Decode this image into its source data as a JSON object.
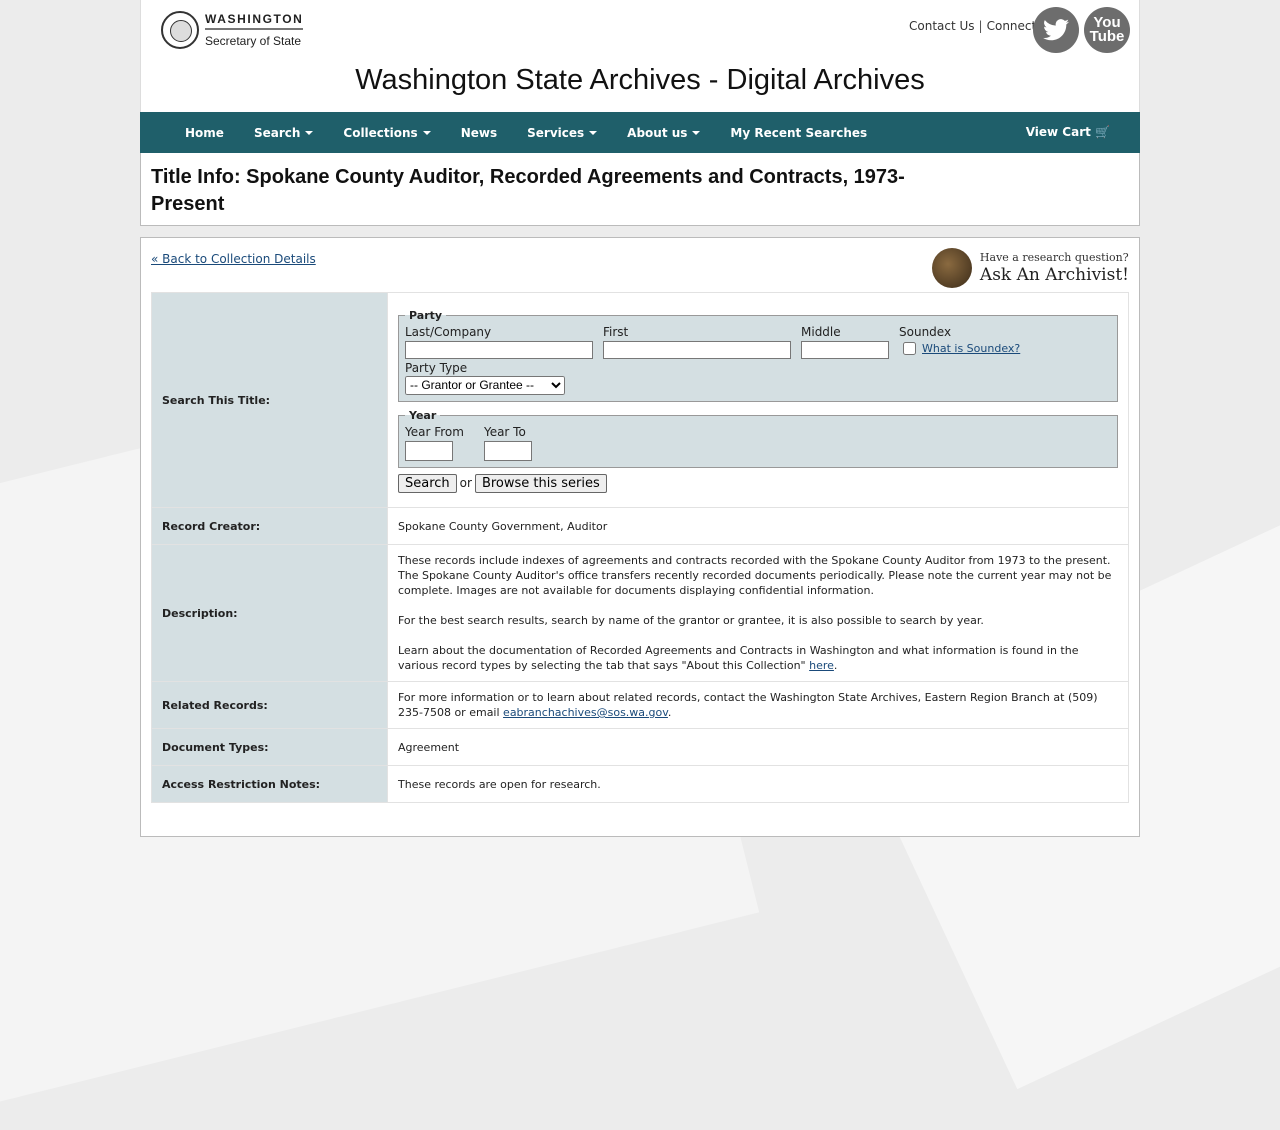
{
  "header": {
    "logo_line1": "WASHINGTON",
    "logo_line2": "Secretary of State",
    "contact": "Contact Us",
    "separator": "|",
    "connect": "Connect:",
    "youtube_label": "You\nTube",
    "site_title": "Washington State Archives - Digital Archives"
  },
  "nav": {
    "items": [
      {
        "label": "Home"
      },
      {
        "label": "Search"
      },
      {
        "label": "Collections"
      },
      {
        "label": "News"
      },
      {
        "label": "Services"
      },
      {
        "label": "About us"
      },
      {
        "label": "My Recent Searches"
      }
    ],
    "cart": "View Cart 🛒"
  },
  "page_title": "Title Info: Spokane County Auditor, Recorded Agreements and Contracts, 1973-Present",
  "back_link": "« Back to Collection Details",
  "archivist": {
    "question": "Have a research question?",
    "ask": "Ask An Archivist!"
  },
  "search": {
    "label": "Search This Title:",
    "party_legend": "Party",
    "last_label": "Last/Company",
    "first_label": "First",
    "middle_label": "Middle",
    "soundex_label": "Soundex",
    "soundex_link": "What is Soundex?",
    "party_type_label": "Party Type",
    "party_type_value": "-- Grantor or Grantee --",
    "year_legend": "Year",
    "year_from_label": "Year From",
    "year_to_label": "Year To",
    "search_button": "Search",
    "or": "or",
    "browse_button": "Browse this series"
  },
  "rows": {
    "creator_label": "Record Creator:",
    "creator_value": "Spokane County Government, Auditor",
    "description_label": "Description:",
    "description_p1": "These records include indexes of agreements and contracts recorded with the Spokane County Auditor from 1973 to the present. The Spokane County Auditor's office transfers recently recorded documents periodically. Please note the current year may not be complete. Images are not available for documents displaying confidential information.",
    "description_p2": "For the best search results, search by name of the grantor or grantee, it is also possible to search by year.",
    "description_p3": "Learn about the documentation of Recorded Agreements and Contracts in Washington and what information is found in the various record types by selecting the tab that says \"About this Collection\"",
    "description_p3_link": "here",
    "related_label": "Related Records:",
    "related_value": "For more information or to learn about related records, contact the Washington State Archives, Eastern Region Branch at (509) 235-7508 or email",
    "related_email": "eabranchachives@sos.wa.gov",
    "doctypes_label": "Document Types:",
    "doctypes_value": "Agreement",
    "access_label": "Access Restriction Notes:",
    "access_value": "These records are open for research."
  }
}
